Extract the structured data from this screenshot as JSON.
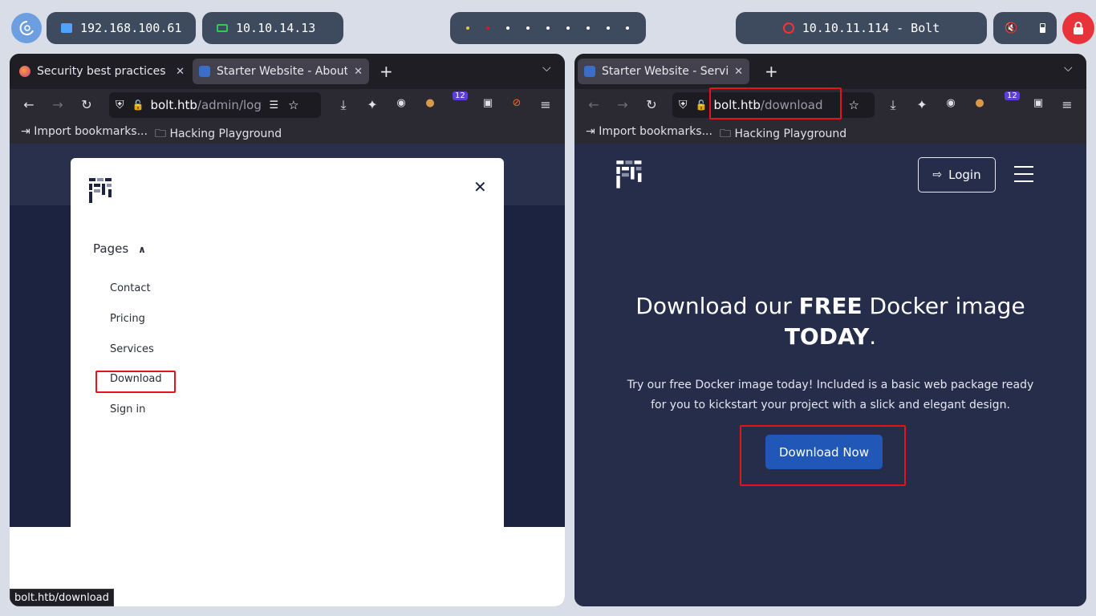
{
  "topbar": {
    "ip_local": "192.168.100.61",
    "ip_vpn": "10.10.14.13",
    "target": "10.10.11.114 - Bolt",
    "workspace_dot_colors": [
      "#f2c230",
      "#e5141b",
      "#ffffff",
      "#ffffff",
      "#ffffff",
      "#ffffff",
      "#ffffff",
      "#ffffff",
      "#ffffff"
    ]
  },
  "left_browser": {
    "tabs": [
      {
        "title": "Security best practices |",
        "active": false,
        "favicon": "firefox-icon"
      },
      {
        "title": "Starter Website - About",
        "active": true,
        "favicon": "site-icon"
      }
    ],
    "url": {
      "domain": "bolt.htb",
      "path": "/admin/login"
    },
    "extension_badge": "12",
    "bookmarks": [
      "Import bookmarks...",
      "Hacking Playground"
    ],
    "modal": {
      "section": "Pages",
      "items": [
        "Contact",
        "Pricing",
        "Services",
        "Download",
        "Sign in"
      ]
    },
    "status_url": "bolt.htb/download"
  },
  "right_browser": {
    "tab": {
      "title": "Starter Website - Service",
      "active": true
    },
    "url": {
      "domain": "bolt.htb",
      "path": "/download"
    },
    "extension_badge": "12",
    "bookmarks": [
      "Import bookmarks...",
      "Hacking Playground"
    ],
    "page": {
      "login_label": "Login",
      "hero_pre": "Download our ",
      "hero_bold": "FREE",
      "hero_mid": " Docker image",
      "hero_bold2": "TODAY",
      "hero_end": ".",
      "hero_text": "Try our free Docker image today! Included is a basic web package ready for you to kickstart your project with a slick and elegant design.",
      "download_button": "Download Now"
    }
  },
  "colors": {
    "highlight": "#e5141b",
    "primary_button": "#2158b8",
    "page_dark": "#252d4b"
  }
}
